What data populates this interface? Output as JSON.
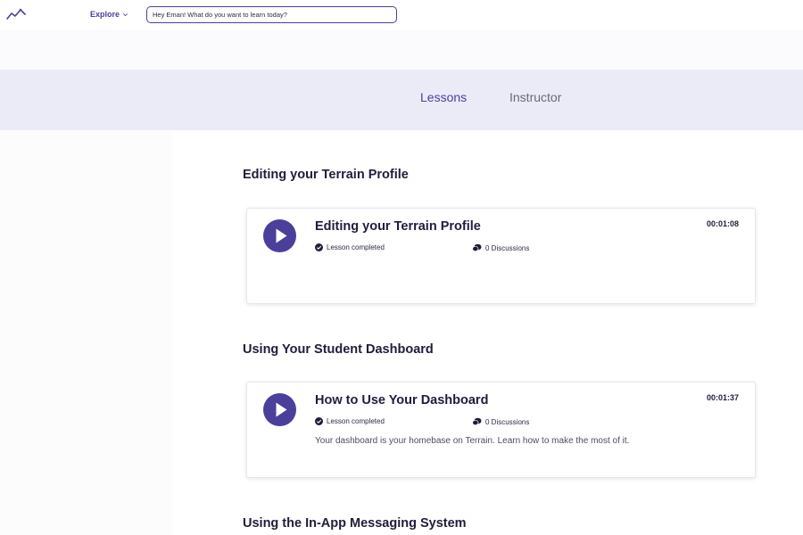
{
  "header": {
    "logo_icon": "trend-line-logo",
    "explore_label": "Explore",
    "search_placeholder": "Hey Eman! What do you want to learn today?"
  },
  "tabs": [
    {
      "label": "Lessons",
      "active": true
    },
    {
      "label": "Instructor",
      "active": false
    }
  ],
  "sections": [
    {
      "title": "Editing your Terrain Profile",
      "lesson": {
        "title": "Editing your Terrain Profile",
        "duration": "00:01:08",
        "status": "Lesson completed",
        "discussions": "0 Discussions",
        "description": ""
      }
    },
    {
      "title": "Using Your Student Dashboard",
      "lesson": {
        "title": "How to Use Your Dashboard",
        "duration": "00:01:37",
        "status": "Lesson completed",
        "discussions": "0 Discussions",
        "description": "Your dashboard is your homebase on Terrain. Learn how to make the most of it."
      }
    },
    {
      "title": "Using the In-App Messaging System"
    }
  ],
  "colors": {
    "accent": "#4a3f9f",
    "tabs_band": "#ebebf8",
    "play_button": "#4b3f9c"
  }
}
